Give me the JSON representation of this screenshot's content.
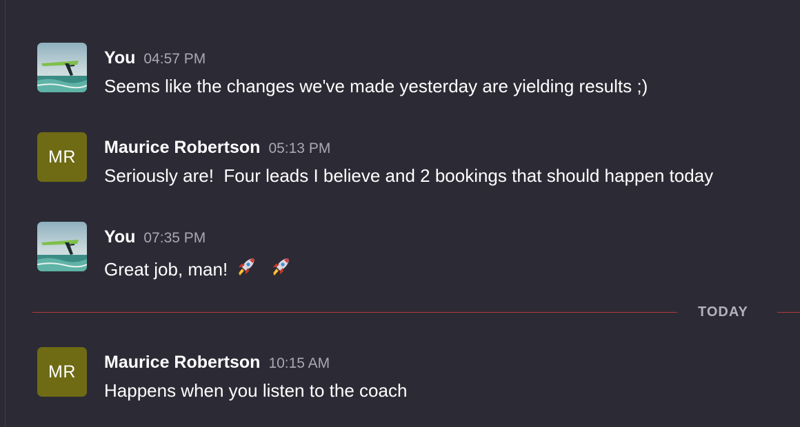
{
  "messages": [
    {
      "author": "You",
      "time": "04:57 PM",
      "text": "Seems like the changes we've made yesterday are yielding results ;)",
      "avatar": {
        "type": "photo",
        "icon": "windsurfer-photo"
      }
    },
    {
      "author": "Maurice Robertson",
      "time": "05:13 PM",
      "text": "Seriously are!  Four leads I believe and 2 bookings that should happen today",
      "avatar": {
        "type": "initials",
        "initials": "MR",
        "color": "#6e6b14"
      }
    },
    {
      "author": "You",
      "time": "07:35 PM",
      "text": "Great job, man!",
      "emoji": [
        "rocket-icon",
        "rocket-icon"
      ],
      "avatar": {
        "type": "photo",
        "icon": "windsurfer-photo"
      }
    },
    {
      "author": "Maurice Robertson",
      "time": "10:15 AM",
      "text": "Happens when you listen to the coach",
      "avatar": {
        "type": "initials",
        "initials": "MR",
        "color": "#6e6b14"
      }
    }
  ],
  "divider": {
    "label": "TODAY",
    "color": "#b7393a"
  },
  "colors": {
    "background": "#2c2b35",
    "author": "#ffffff",
    "timestamp": "#a9a8b3"
  }
}
